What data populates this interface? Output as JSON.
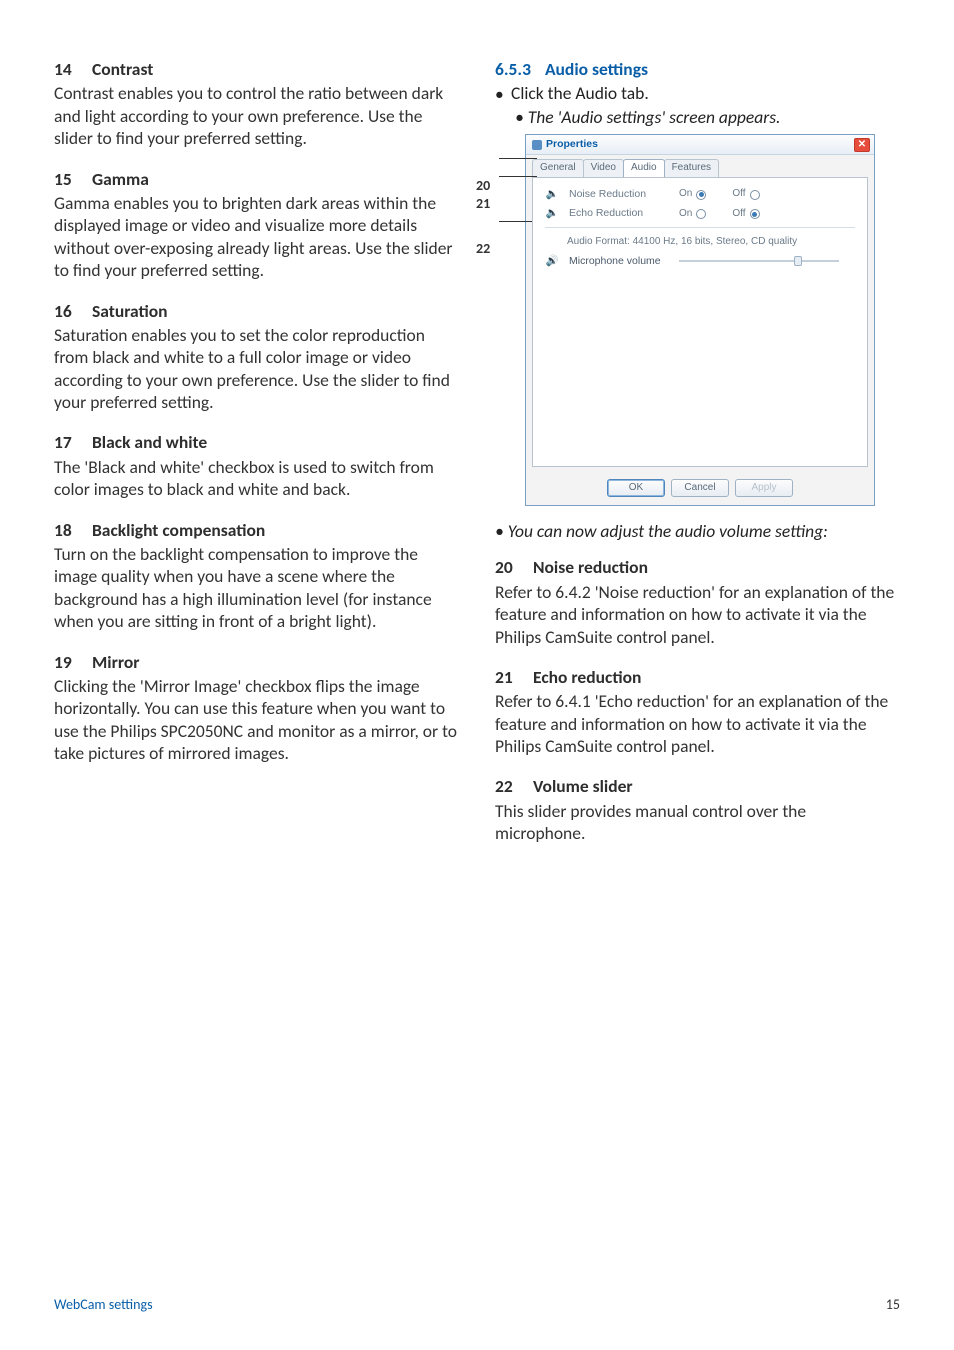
{
  "left": {
    "s14": {
      "num": "14",
      "title": "Contrast",
      "body": "Contrast enables you to control the ratio between dark and light according to your own preference. Use the slider to find your preferred setting."
    },
    "s15": {
      "num": "15",
      "title": "Gamma",
      "body": "Gamma enables you to brighten dark areas within the displayed image or video and visualize more details without over-exposing already light areas. Use the slider to find your preferred setting."
    },
    "s16": {
      "num": "16",
      "title": "Saturation",
      "body": "Saturation enables you to set the color reproduction from black and white to a full color image or video according to your own preference. Use the slider to find your preferred setting."
    },
    "s17": {
      "num": "17",
      "title": "Black and white",
      "body": "The 'Black and white' checkbox is used to switch from color images to black and white and back."
    },
    "s18": {
      "num": "18",
      "title": "Backlight compensation",
      "body": "Turn on the backlight compensation to improve the image quality when you have a scene where the background has a high illumination level (for instance when you are sitting in front of a bright light)."
    },
    "s19": {
      "num": "19",
      "title": "Mirror",
      "body": "Clicking the 'Mirror Image' checkbox flips the image horizontally. You can use this feature when you want to use the Philips SPC2050NC and monitor as a mirror, or to take pictures of mirrored images."
    }
  },
  "right": {
    "heading": {
      "num": "6.5.3",
      "title": "Audio settings"
    },
    "step1": "Click the Audio tab.",
    "step1_result": "The 'Audio settings' screen appears.",
    "after_dialog": "You can now adjust the audio volume setting:",
    "s20": {
      "num": "20",
      "title": "Noise reduction",
      "body": "Refer to 6.4.2 'Noise reduction' for an explanation of the feature and information on how to activate it via the Philips CamSuite control panel."
    },
    "s21": {
      "num": "21",
      "title": "Echo reduction",
      "body": "Refer to 6.4.1 'Echo reduction' for an explanation of the feature and information on how to activate it via the Philips CamSuite control panel."
    },
    "s22": {
      "num": "22",
      "title": "Volume slider",
      "body": "This slider provides manual control over the microphone."
    }
  },
  "callouts": {
    "c20": "20",
    "c21": "21",
    "c22": "22"
  },
  "dialog": {
    "title": "Properties",
    "tabs": {
      "general": "General",
      "video": "Video",
      "audio": "Audio",
      "features": "Features"
    },
    "noise_label": "Noise Reduction",
    "echo_label": "Echo Reduction",
    "on": "On",
    "off": "Off",
    "audio_format": "Audio Format: 44100 Hz, 16 bits, Stereo, CD quality",
    "mic_volume": "Microphone volume",
    "slider_pos_pct": 72,
    "buttons": {
      "ok": "OK",
      "cancel": "Cancel",
      "apply": "Apply"
    }
  },
  "footer": {
    "label": "WebCam settings",
    "page": "15"
  }
}
